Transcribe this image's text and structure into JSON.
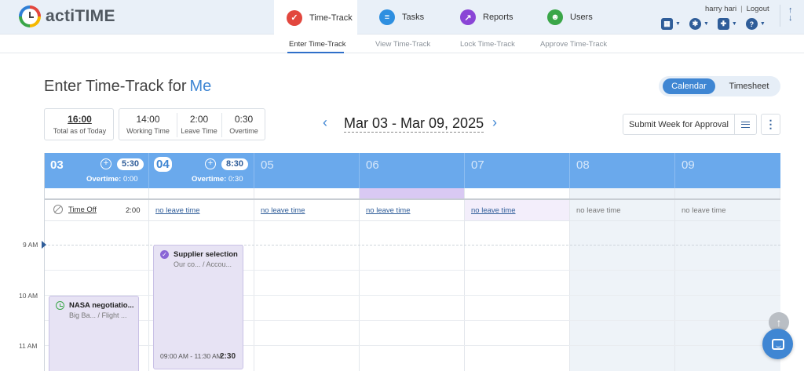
{
  "app": {
    "name": "actiTIME"
  },
  "modules": [
    {
      "label": "Time-Track",
      "icon": "time-track-icon",
      "color": "#e2473e",
      "glyph": "✓"
    },
    {
      "label": "Tasks",
      "icon": "tasks-icon",
      "color": "#2e8fe0",
      "glyph": "≡"
    },
    {
      "label": "Reports",
      "icon": "reports-icon",
      "color": "#8a45d6",
      "glyph": "↗"
    },
    {
      "label": "Users",
      "icon": "users-icon",
      "color": "#3aa648",
      "glyph": "☻"
    }
  ],
  "user": {
    "name": "harry hari",
    "logout": "Logout"
  },
  "subnav": [
    "Enter Time-Track",
    "View Time-Track",
    "Lock Time-Track",
    "Approve Time-Track"
  ],
  "page": {
    "title": "Enter Time-Track for",
    "person": "Me"
  },
  "view_toggle": {
    "active": "Calendar",
    "other": "Timesheet"
  },
  "stats": {
    "total": {
      "value": "16:00",
      "label": "Total as of Today"
    },
    "working": {
      "value": "14:00",
      "label": "Working Time"
    },
    "leave": {
      "value": "2:00",
      "label": "Leave Time"
    },
    "overtime": {
      "value": "0:30",
      "label": "Overtime"
    }
  },
  "week": {
    "range": "Mar 03 - Mar 09, 2025",
    "prev": "‹",
    "next": "›"
  },
  "actions": {
    "submit": "Submit Week for Approval",
    "more": "⋮"
  },
  "days": [
    {
      "num": "03",
      "total": "5:30",
      "overtime_label": "Overtime:",
      "overtime": "0:00",
      "leave": ""
    },
    {
      "num": "04",
      "total": "8:30",
      "overtime_label": "Overtime:",
      "overtime": "0:30",
      "leave": "no leave time"
    },
    {
      "num": "05",
      "leave": "no leave time"
    },
    {
      "num": "06",
      "leave": "no leave time"
    },
    {
      "num": "07",
      "leave": "no leave time"
    },
    {
      "num": "08",
      "leave": "no leave time"
    },
    {
      "num": "09",
      "leave": "no leave time"
    }
  ],
  "time_off": {
    "label": "Time Off",
    "value": "2:00"
  },
  "time_labels": [
    "9 AM",
    "10 AM",
    "11 AM"
  ],
  "tasks": [
    {
      "title": "Supplier selection",
      "sub": "Our co... / Accou...",
      "time": "09:00 AM - 11:30 AM",
      "duration": "2:30"
    },
    {
      "title": "NASA negotiatio...",
      "sub": "Big Ba... / Flight ..."
    }
  ],
  "colors": {
    "accent": "#3f86d3",
    "header_bg": "#6aa9ec",
    "task_bg": "#e7e3f4",
    "today_strip": "#d9c9f3"
  }
}
